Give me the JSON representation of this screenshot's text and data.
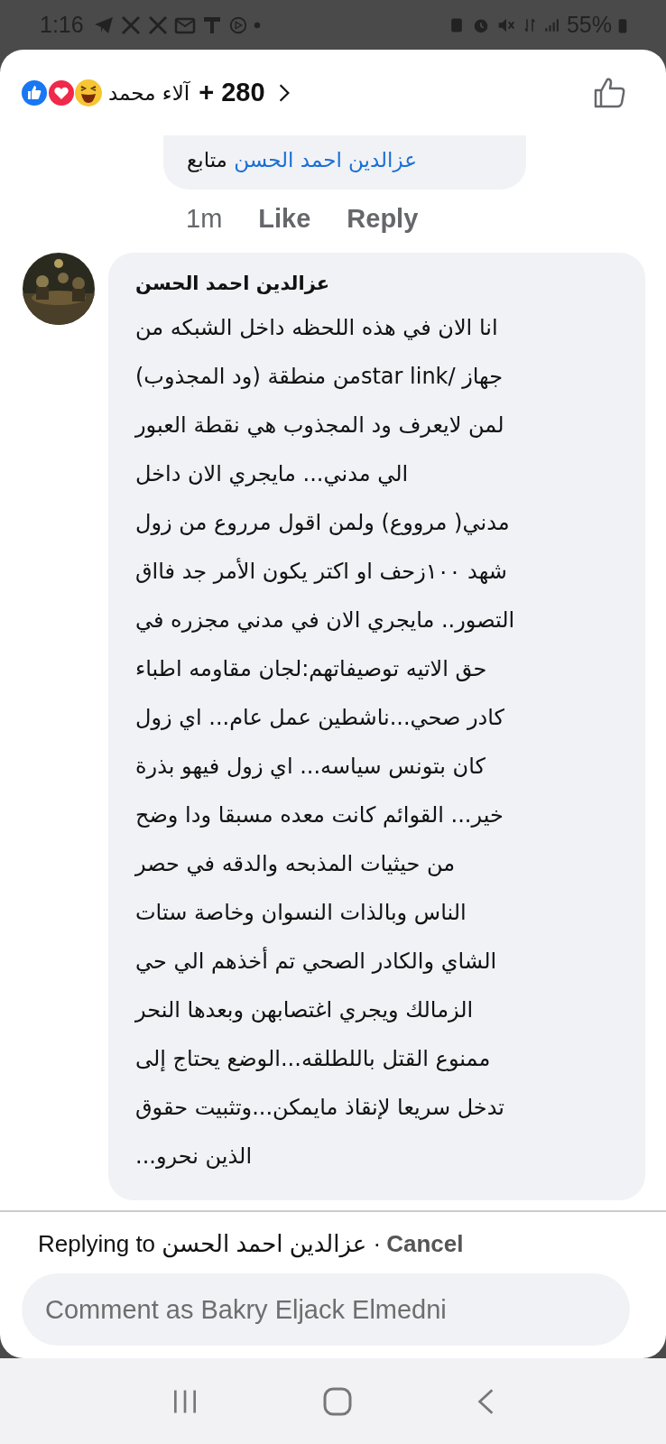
{
  "status_bar": {
    "time": "1:16",
    "battery": "55%"
  },
  "header": {
    "reactor": "آلاء محمد",
    "count": "+ 280"
  },
  "reply": {
    "mention": "عزالدين احمد الحسن",
    "text": "متابع",
    "time": "1m",
    "like": "Like",
    "reply": "Reply"
  },
  "comment": {
    "author": "عزالدين احمد الحسن",
    "lines": [
      "انا الان في هذه اللحظه داخل الشبكه من",
      "جهاز /star linkمن منطقة (ود المجذوب)",
      "لمن لايعرف ود المجذوب هي نقطة العبور",
      "الي مدني... مايجري الان داخل",
      "مدني( مرووع) ولمن اقول مرروع من زول",
      "شهد ١٠٠زحف او اكتر يكون الأمر جد فااق",
      "التصور.. مايجري الان في مدني مجزره في",
      "حق الاتيه توصيفاتهم:لجان مقاومه اطباء",
      "كادر صحي...ناشطين عمل عام... اي زول",
      "كان بتونس سياسه... اي زول فيهو بذرة",
      "خير... القوائم كانت معده مسبقا ودا وضح",
      "من حيثيات المذبحه والدقه في حصر",
      "الناس وبالذات النسوان وخاصة ستات",
      "الشاي والكادر الصحي تم أخذهم الي حي",
      "الزمالك ويجري اغتصابهن وبعدها النحر",
      "ممنوع القتل باللطلقه...الوضع يحتاج إلى",
      "تدخل سريعا لإنقاذ مايمكن...وتثبيت حقوق",
      "الذين نحرو..."
    ]
  },
  "replying": {
    "text": "Replying to عزالدين احمد الحسن ·",
    "cancel": "Cancel"
  },
  "composer": {
    "placeholder": "Comment as Bakry Eljack Elmedni"
  }
}
